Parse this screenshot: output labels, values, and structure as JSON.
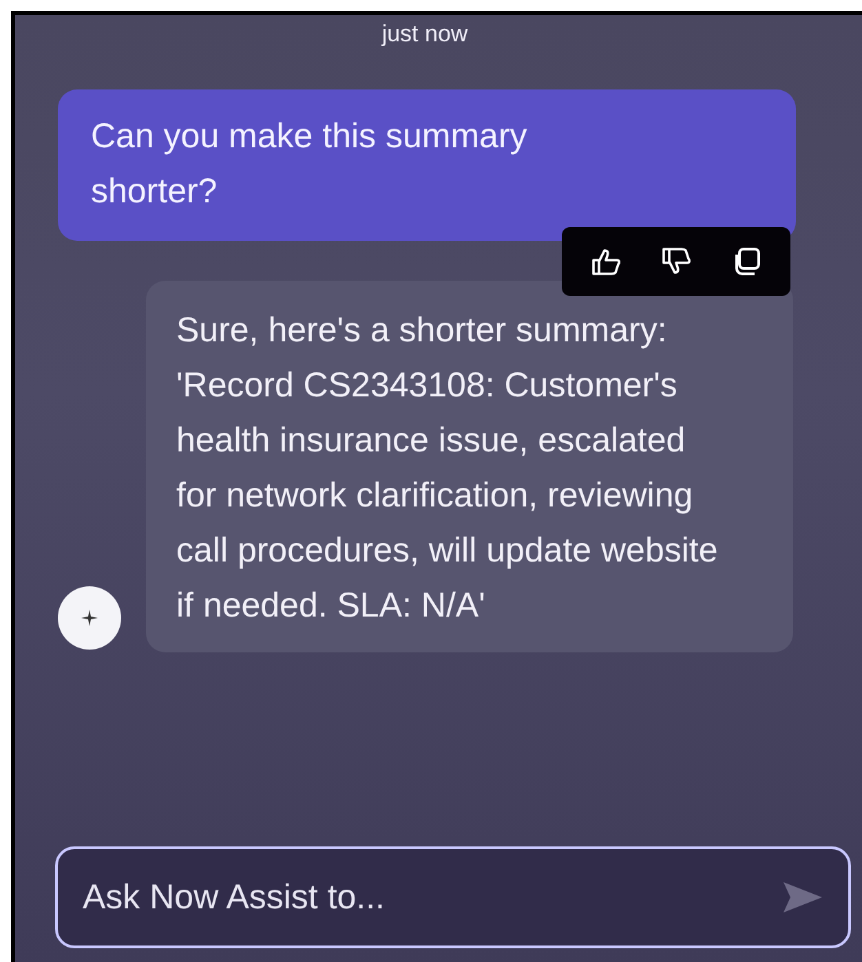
{
  "timestamp": "just now",
  "messages": [
    {
      "kind": "user",
      "text": "Can you make this summary shorter?"
    },
    {
      "kind": "assistant",
      "text": "Sure, here's a shorter summary: 'Record CS2343108: Customer's health insurance issue, escalated for network clarification, reviewing call procedures, will update website if needed. SLA: N/A'"
    }
  ],
  "composer": {
    "placeholder": "Ask Now Assist to..."
  }
}
